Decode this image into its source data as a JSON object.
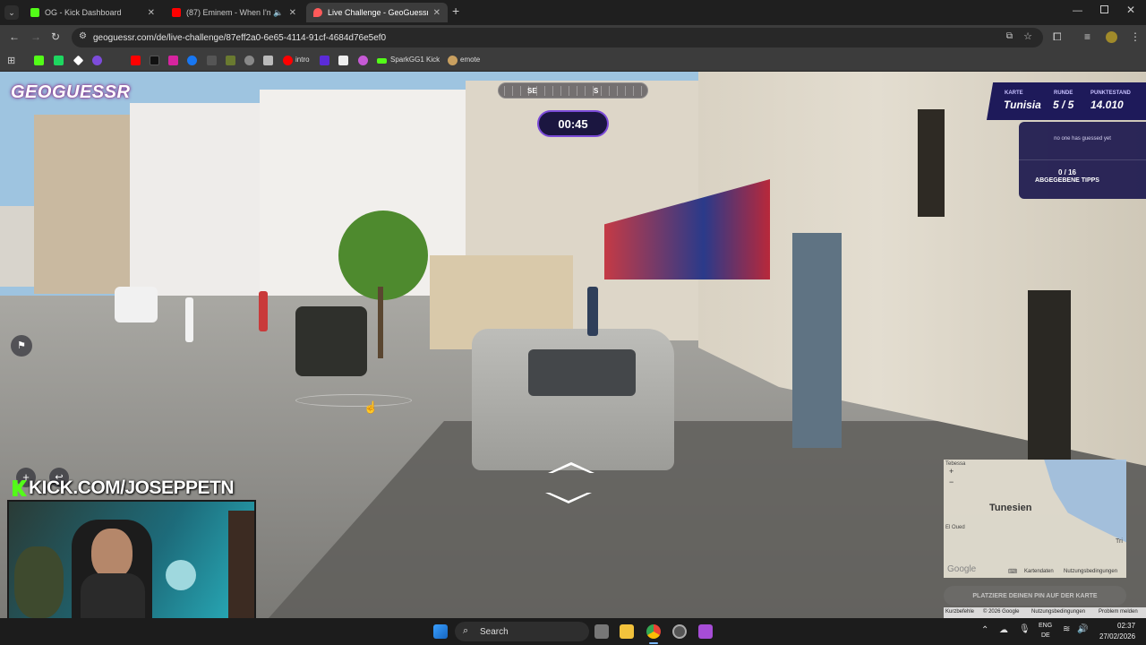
{
  "browser": {
    "tabs": [
      {
        "title": "OG - Kick Dashboard"
      },
      {
        "title": "(87) Eminem - When I'm Gone"
      },
      {
        "title": "Live Challenge - GeoGuessr"
      }
    ],
    "url": "geoguessr.com/de/live-challenge/87eff2a0-6e65-4114-91cf-4684d76e5ef0",
    "bookmarks": {
      "intro": "intro",
      "sparkgg1": "SparkGG1 Kick",
      "emote": "emote"
    }
  },
  "game": {
    "logo": "GEOGUESSR",
    "compass": {
      "se": "SE",
      "s": "S"
    },
    "timer": "00:45",
    "scoreboard": {
      "map_label": "KARTE",
      "map_value": "Tunisia",
      "round_label": "RUNDE",
      "round_value": "5 / 5",
      "points_label": "PUNKTESTAND",
      "points_value": "14.010"
    },
    "guess_status": "no one has guessed yet",
    "tips_count": "0 / 16",
    "tips_label": "ABGEGEBENE TIPPS",
    "minimap": {
      "country": "Tunesien",
      "city_left": "El Oued",
      "city_top": "Tebessa",
      "city_right": "Tri",
      "google": "Google",
      "kartendaten": "Kartendaten",
      "nutzung": "Nutzungsbedingungen"
    },
    "place_pin": "PLATZIERE DEINEN PIN AUF DER KARTE",
    "footer": {
      "shortcuts": "Kurzbefehle",
      "copyright": "© 2026 Google",
      "terms": "Nutzungsbedingungen",
      "report": "Problem melden"
    }
  },
  "overlay": {
    "kick_handle": "KICK.COM/JOSEPPETN"
  },
  "taskbar": {
    "search": "Search",
    "lang_top": "ENG",
    "lang_bottom": "DE",
    "time": "02:37",
    "date": "27/02/2026"
  },
  "colors": {
    "gg_purple": "#1e1a5a",
    "kick_green": "#53fc18",
    "timer_border": "#7b4bd8"
  }
}
